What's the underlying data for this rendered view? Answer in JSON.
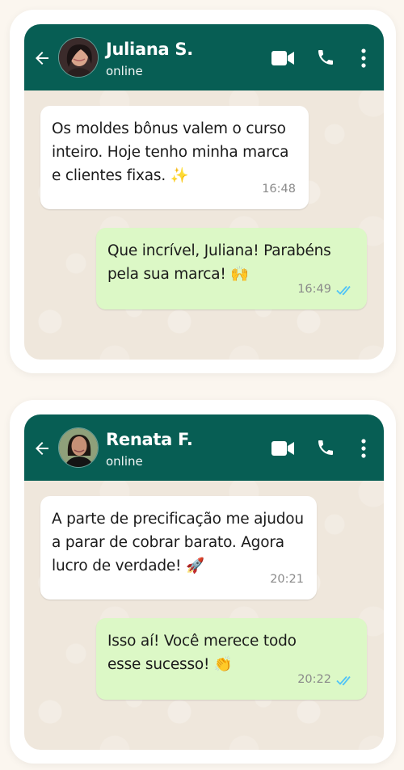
{
  "chats": [
    {
      "contact": {
        "name": "Juliana S.",
        "status": "online"
      },
      "messages": [
        {
          "direction": "in",
          "text": "Os moldes bônus valem o curso\ninteiro. Hoje tenho minha marca\ne clientes fixas. ✨",
          "time": "16:48"
        },
        {
          "direction": "out",
          "text": "Que incrível, Juliana! Parabéns\npela sua marca! 🙌",
          "time": "16:49",
          "status": "read"
        }
      ]
    },
    {
      "contact": {
        "name": "Renata F.",
        "status": "online"
      },
      "messages": [
        {
          "direction": "in",
          "text": "A parte de precificação me ajudou\na parar de cobrar barato. Agora\nlucro de verdade! 🚀",
          "time": "20:21"
        },
        {
          "direction": "out",
          "text": "Isso aí! Você merece todo\nesse sucesso! 👏",
          "time": "20:22",
          "status": "read"
        }
      ]
    }
  ],
  "colors": {
    "header": "#075e54",
    "incoming": "#ffffff",
    "outgoing": "#dcf8c6",
    "read_tick": "#4fc3f7",
    "wallpaper": "#efe7dc"
  },
  "icons": [
    "back-arrow-icon",
    "video-call-icon",
    "phone-icon",
    "more-vert-icon",
    "double-check-icon"
  ]
}
